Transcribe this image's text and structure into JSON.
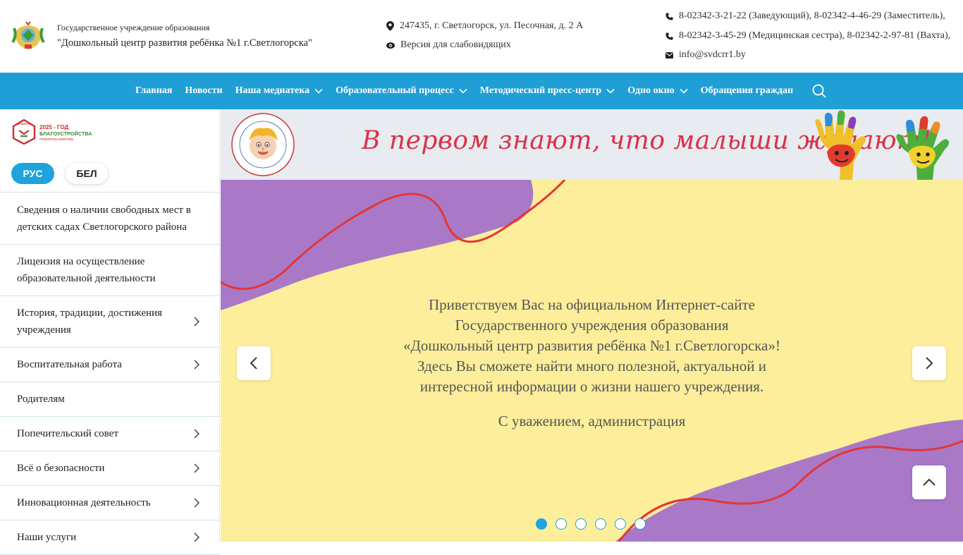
{
  "header": {
    "org_subtitle": "Государственное учреждение образования",
    "org_name": "\"Дошкольный центр развития ребёнка №1 г.Светлогорска\"",
    "address": "247435, г. Светлогорск, ул. Песочная, д. 2 А",
    "low_vision_label": "Версия для слабовидящих",
    "phone_line_1": "8-02342-3-21-22 (Заведующий), 8-02342-4-46-29 (Заместитель),",
    "phone_line_2": "8-02342-3-45-29 (Медицинская сестра), 8-02342-2-97-81 (Вахта),",
    "email": "info@svdcrr1.by"
  },
  "nav": {
    "items": [
      {
        "label": "Главная",
        "has_dropdown": false
      },
      {
        "label": "Новости",
        "has_dropdown": false
      },
      {
        "label": "Наша медиатека",
        "has_dropdown": true
      },
      {
        "label": "Образовательный процесс",
        "has_dropdown": true
      },
      {
        "label": "Методический пресс-центр",
        "has_dropdown": true
      },
      {
        "label": "Одно окно",
        "has_dropdown": true
      },
      {
        "label": "Обращения граждан",
        "has_dropdown": false
      }
    ]
  },
  "sidebar": {
    "year_badge": {
      "country": "БЕЛАРУСЬ",
      "year_line": "2025 - ГОД",
      "theme_line": "БЛАГОУСТРОЙСТВА",
      "motto_line": "пятилетка качества"
    },
    "lang_ru": "РУС",
    "lang_by": "БЕЛ",
    "items": [
      {
        "label": "Сведения о наличии свободных мест в детских садах Светлогорского района",
        "has_children": false
      },
      {
        "label": "Лицензия на осуществление образовательной деятельности",
        "has_children": false
      },
      {
        "label": "История, традиции, достижения учреждения",
        "has_children": true
      },
      {
        "label": "Воспитательная работа",
        "has_children": true
      },
      {
        "label": "Родителям",
        "has_children": false
      },
      {
        "label": "Попечительский совет",
        "has_children": true
      },
      {
        "label": "Всё о безопасности",
        "has_children": true
      },
      {
        "label": "Инновационная деятельность",
        "has_children": true
      },
      {
        "label": "Наши услуги",
        "has_children": true
      }
    ]
  },
  "banner": {
    "slogan": "В первом знают, что малыши желают!"
  },
  "slider": {
    "lines": [
      "Приветствуем Вас на официальном Интернет-сайте",
      "Государственного учреждения образования",
      "«Дошкольный центр развития ребёнка №1 г.Светлогорска»!",
      "Здесь Вы сможете найти много полезной, актуальной и",
      "интересной информации о жизни нашего учреждения."
    ],
    "regards": "С уважением, администрация",
    "slide_count": 6,
    "active_slide": 1
  },
  "colors": {
    "accent": "#1f9fd5",
    "slide_yellow": "#fcee9a",
    "slide_purple": "#a979c8",
    "slide_wave": "#e53535",
    "slogan_red": "#d9324a"
  }
}
